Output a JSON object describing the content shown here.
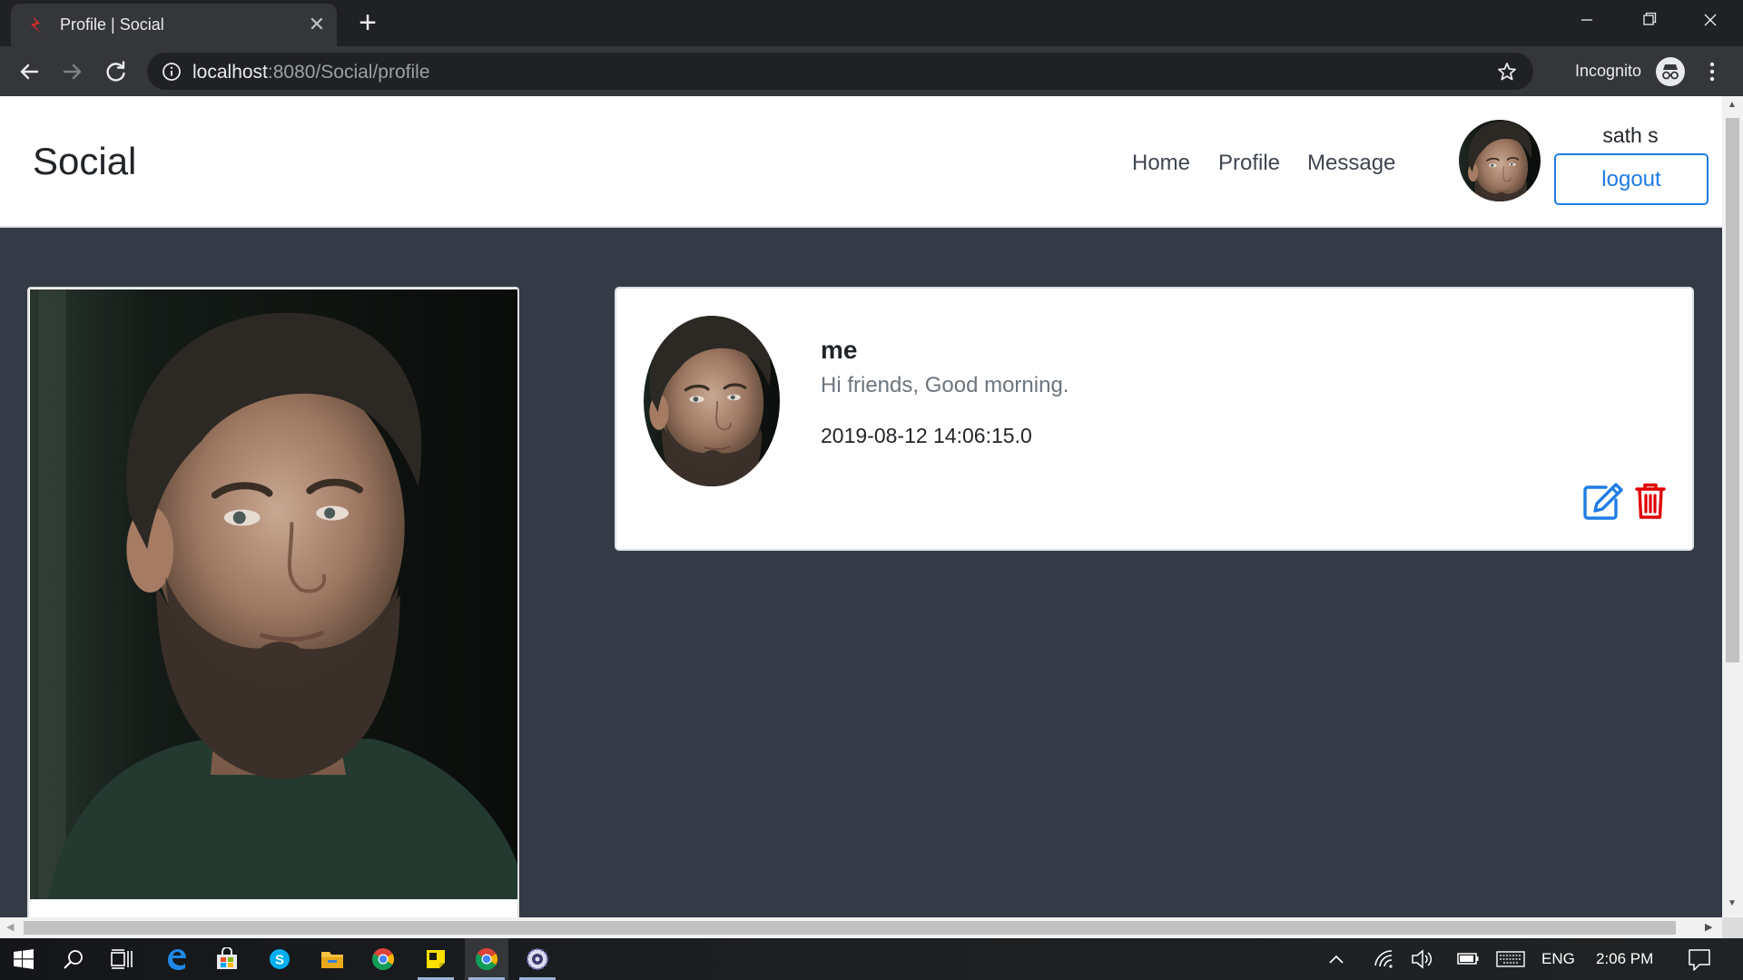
{
  "browser": {
    "tab_title": "Profile | Social",
    "url_host": "localhost",
    "url_rest": ":8080/Social/profile",
    "incognito_label": "Incognito"
  },
  "site": {
    "brand": "Social",
    "nav": [
      {
        "label": "Home"
      },
      {
        "label": "Profile"
      },
      {
        "label": "Message"
      }
    ],
    "username": "sath s",
    "logout_label": "logout",
    "accent_color": "#1f7ce6",
    "danger_color": "#e00000"
  },
  "post": {
    "author": "me",
    "text": "Hi friends, Good morning.",
    "timestamp": "2019-08-12 14:06:15.0"
  },
  "taskbar": {
    "language": "ENG",
    "clock": "2:06 PM",
    "apps": [
      "windows-start-icon",
      "search-icon",
      "task-view-icon",
      "edge-icon",
      "store-icon",
      "skype-icon",
      "file-explorer-icon",
      "chrome-icon",
      "sticky-notes-icon",
      "chrome-incognito-icon",
      "settings-app-icon"
    ]
  }
}
